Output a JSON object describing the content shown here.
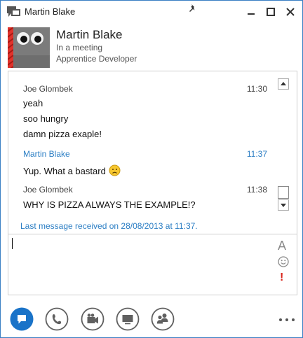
{
  "window": {
    "title": "Martin Blake"
  },
  "contact": {
    "name": "Martin Blake",
    "status": "In a meeting",
    "job_title": "Apprentice Developer",
    "presence_color": "#e0322b"
  },
  "conversation": {
    "messages": [
      {
        "sender": "Joe Glombek",
        "time": "11:30",
        "lines": [
          "yeah",
          "soo hungry",
          "damn pizza exaple!"
        ]
      },
      {
        "sender": "Martin Blake",
        "time": "11:37",
        "lines": [
          "Yup. What a bastard"
        ],
        "emoticon": "sad-face"
      },
      {
        "sender": "Joe Glombek",
        "time": "11:38",
        "lines": [
          "WHY IS PIZZA ALWAYS THE EXAMPLE!?"
        ]
      }
    ],
    "last_message_info": "Last message received on 28/08/2013 at 11:37."
  },
  "input": {
    "value": "",
    "font_button_glyph": "A",
    "importance_glyph": "!"
  },
  "toolbar": {
    "buttons": [
      "im",
      "phone",
      "video",
      "present",
      "participants"
    ],
    "more_icon": "more-dots",
    "accent": "#1a73c8"
  }
}
